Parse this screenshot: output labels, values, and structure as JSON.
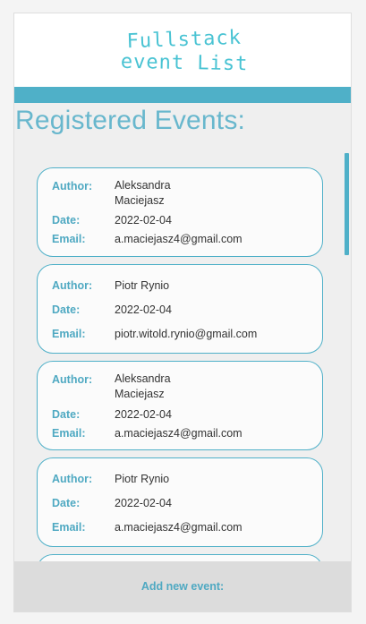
{
  "header": {
    "logo_text_line1": "Fullstack",
    "logo_text_line2": "event List",
    "logo_color": "#49c3d3"
  },
  "accent_color": "#4fb0c8",
  "page_title": "Registered Events:",
  "labels": {
    "author": "Author:",
    "date": "Date:",
    "email": "Email:"
  },
  "events": [
    {
      "author": "Aleksandra Maciejasz",
      "author_line1": "Aleksandra",
      "author_line2": "Maciejasz",
      "date": "2022-02-04",
      "email": "a.maciejasz4@gmail.com"
    },
    {
      "author": "Piotr Rynio",
      "date": "2022-02-04",
      "email": "piotr.witold.rynio@gmail.com"
    },
    {
      "author": "Aleksandra Maciejasz",
      "author_line1": "Aleksandra",
      "author_line2": "Maciejasz",
      "date": "2022-02-04",
      "email": "a.maciejasz4@gmail.com"
    },
    {
      "author": "Piotr Rynio",
      "date": "2022-02-04",
      "email": "a.maciejasz4@gmail.com"
    }
  ],
  "footer": {
    "add_button_label": "Add new event:"
  }
}
